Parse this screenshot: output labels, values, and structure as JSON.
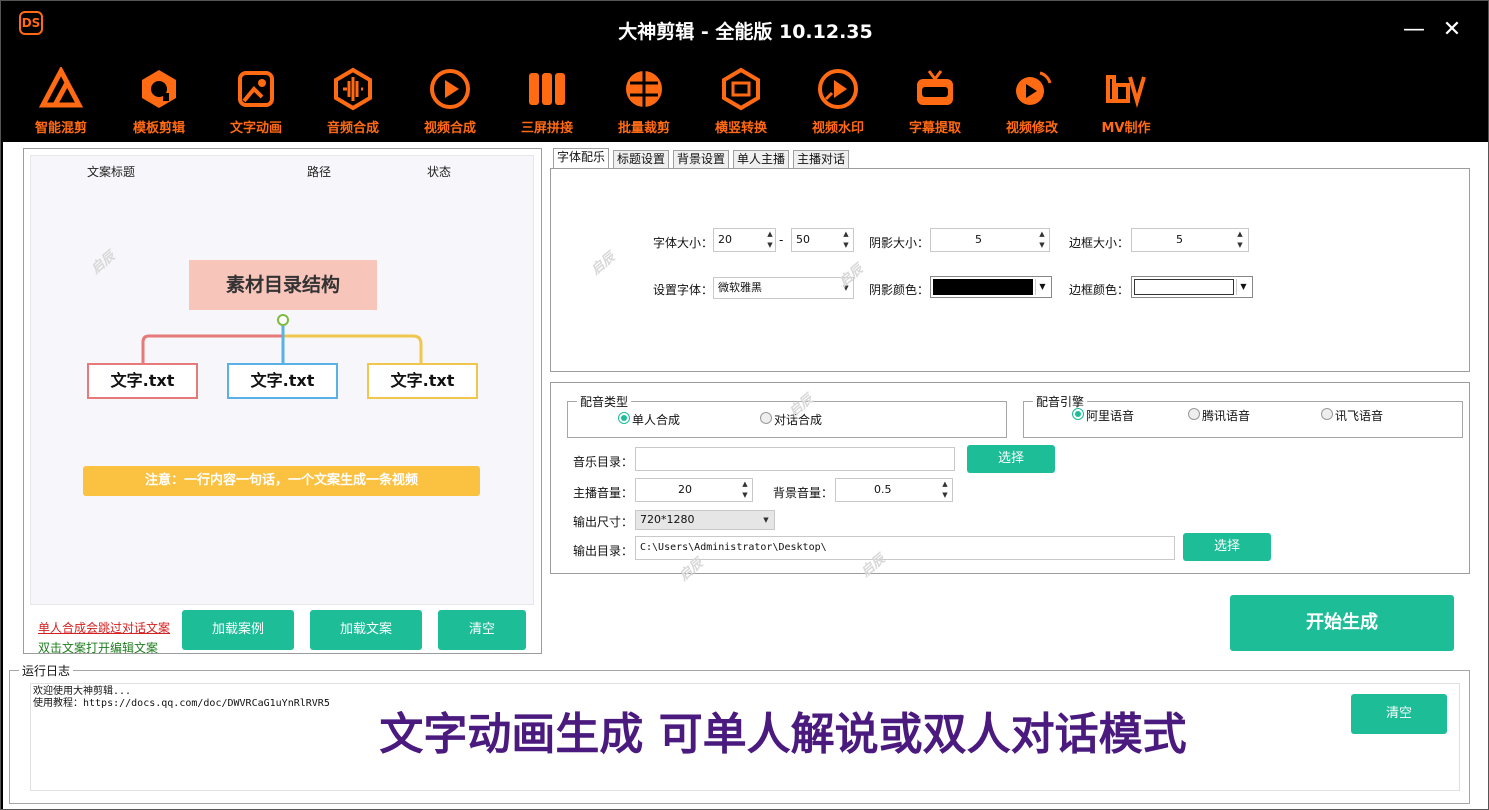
{
  "app": {
    "title": "大神剪辑 - 全能版 10.12.35",
    "logo_text": "DS",
    "minimize": "—",
    "close": "✕"
  },
  "toolbar": [
    {
      "label": "智能混剪",
      "icon": "smart-mix-icon"
    },
    {
      "label": "模板剪辑",
      "icon": "template-edit-icon"
    },
    {
      "label": "文字动画",
      "icon": "text-animation-icon",
      "active": true
    },
    {
      "label": "音频合成",
      "icon": "audio-synthesis-icon"
    },
    {
      "label": "视频合成",
      "icon": "video-synthesis-icon"
    },
    {
      "label": "三屏拼接",
      "icon": "triple-screen-icon"
    },
    {
      "label": "批量裁剪",
      "icon": "batch-crop-icon"
    },
    {
      "label": "横竖转换",
      "icon": "orientation-convert-icon"
    },
    {
      "label": "视频水印",
      "icon": "video-watermark-icon"
    },
    {
      "label": "字幕提取",
      "icon": "subtitle-extract-icon"
    },
    {
      "label": "视频修改",
      "icon": "video-modify-icon"
    },
    {
      "label": "MV制作",
      "icon": "mv-make-icon"
    }
  ],
  "left": {
    "columns": [
      "文案标题",
      "路径",
      "状态"
    ],
    "diagram": {
      "root": "素材目录结构",
      "children": [
        "文字.txt",
        "文字.txt",
        "文字.txt"
      ],
      "note": "注意：一行内容一句话，一个文案生成一条视频"
    },
    "hint_red": "单人合成会跳过对话文案",
    "hint_green": "双击文案打开编辑文案",
    "buttons": [
      "加载案例",
      "加载文案",
      "清空"
    ]
  },
  "tabs": [
    "字体配乐",
    "标题设置",
    "背景设置",
    "单人主播",
    "主播对话"
  ],
  "font": {
    "size_label": "字体大小：",
    "size_min": "20",
    "dash": "-",
    "size_max": "50",
    "shadow_size_label": "阴影大小：",
    "shadow_size": "5",
    "border_size_label": "边框大小：",
    "border_size": "5",
    "font_label": "设置字体：",
    "font_value": "微软雅黑",
    "shadow_color_label": "阴影颜色：",
    "shadow_color": "#000000",
    "border_color_label": "边框颜色：",
    "border_color": "#ffffff"
  },
  "voice": {
    "type_title": "配音类型",
    "type_options": [
      "单人合成",
      "对话合成"
    ],
    "engine_title": "配音引擎",
    "engine_options": [
      "阿里语音",
      "腾讯语音",
      "讯飞语音"
    ],
    "music_label": "音乐目录：",
    "music_value": "",
    "select": "选择",
    "main_vol_label": "主播音量：",
    "main_vol": "20",
    "bg_vol_label": "背景音量：",
    "bg_vol": "0.5",
    "size_label": "输出尺寸：",
    "size_value": "720*1280",
    "out_label": "输出目录：",
    "out_value": "C:\\Users\\Administrator\\Desktop\\"
  },
  "start_button": "开始生成",
  "log": {
    "title": "运行日志",
    "lines": [
      "欢迎使用大神剪辑...",
      "使用教程：https://docs.qq.com/doc/DWVRCaG1uYnRlRVR5"
    ],
    "clear": "清空"
  },
  "banner": "文字动画生成 可单人解说或双人对话模式",
  "watermark": "启辰",
  "colors": {
    "accent": "#ff6a13",
    "button": "#1dbd98",
    "banner": "#4a1a7e"
  }
}
